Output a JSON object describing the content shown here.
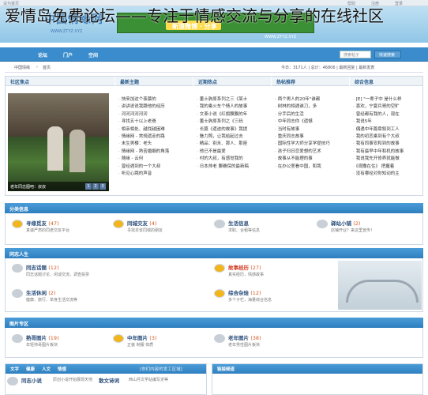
{
  "overlay_title": "爱情岛免费论坛——专注于情感交流与分享的在线社区",
  "top_strip": {
    "left": "设为首页",
    "right": [
      "帮助",
      "注册",
      "登录"
    ]
  },
  "header": {
    "logo": "中国情缘网",
    "url": "WWW.ZTYZ.XYZ",
    "ad_text": "新浪微博 · 分享",
    "ad_url": "WWW.ZTYZ.XYZ"
  },
  "nav": {
    "items": [
      "论坛",
      "门户",
      "空间"
    ],
    "search_placeholder": "搜索帖子",
    "search_button": "快速搜索"
  },
  "crumb": {
    "home": "中国情缘",
    "sep": "›",
    "page": "首页",
    "stats": "今日：3171人 | 总计：46806 | 最新回复 | 最新发表"
  },
  "hot": {
    "columns": [
      "社区焦点",
      "最新主题",
      "近期热点",
      "热帖推荐",
      "综合信息"
    ],
    "photo_caption": "老年同志图吧：叔叔",
    "photo_pages": [
      "1",
      "2",
      "3"
    ],
    "lists": [
      [
        "快来加这个羡慕的",
        "讲讲说说我跟他的经历",
        "河河河河河河",
        "寻找五十以上老爸",
        "相亲相处、越找越困难",
        "情缘网 - 常规遗走的路",
        "未生男楼：老头",
        "情缘网 - 熟苦婚姻的角落",
        "随缘 - 云何",
        "曾经遇到的一个大叔",
        "听见心跳的声音"
      ],
      [
        "董士驹原系列之三《某士",
        "我的乘火车个情人的故事",
        "文革小说《红旗飘飘的年",
        "董士驹原系列之《三码",
        "长篇《遗迹的故事》我提",
        "魅力照，让我给起过去",
        "精品：别永、那人、那座",
        "他已不是最爱",
        "村的大叔，有感觉我的",
        "日本帅老 要确保的最新稿"
      ],
      [
        "两个男人的20年\"谁都",
        "树林的相遇谁刀，多",
        "分手后的生活",
        "中年同志你《遗憾",
        "当时有故事",
        "重庆同志故事",
        "国际性学大师分享学提技巧",
        "孩子归日恋爱想的艺术",
        "故事从不能理的事",
        "在办公室看中国，和我"
      ],
      [
        "[E] \"一辈子中 是什么样",
        "喜欢，宁夏兵哥的空旷",
        "曾经都有我的人，现在",
        "我说5年",
        "偶遇中年篇章叙到工人",
        "我的初恋乘到有个大叔",
        "我有同事安和到的故事",
        "我有最早中年和机的故事",
        "我说我先开修养就能做",
        "《观撒在住》 把握着",
        "没有哪经对你知动的主"
      ]
    ]
  },
  "sections": [
    {
      "title": "分类信息",
      "forums": [
        {
          "name": "寻缘觅友",
          "count": "(47)",
          "desc": "真诚严肃的同老交友平台",
          "hot": true
        },
        {
          "name": "同城交友",
          "count": "(4)",
          "desc": "寻找本省同城的朋友",
          "hot": true
        },
        {
          "name": "生活信息",
          "count": "",
          "desc": "求职、合租等信息",
          "hot": false
        },
        {
          "name": "驿站小铺",
          "count": "(2)",
          "desc": "店铺开业？来这里宣传！",
          "hot": false
        }
      ]
    },
    {
      "title": "同志人生",
      "forums": [
        {
          "name": "同志话题",
          "count": "(12)",
          "desc": "同志话题讨论，闲谈交流，调查投票",
          "hot": false
        },
        {
          "name": "故事经历",
          "count": "(27)",
          "desc": "真实经历，情感故事",
          "hot": true,
          "special": true
        },
        {
          "name": "生活休闲",
          "count": "(2)",
          "desc": "健康、旅行、单身生活交流等",
          "hot": false
        },
        {
          "name": "综合杂烩",
          "count": "(12)",
          "desc": "多个子栏，海量综合信息",
          "hot": true
        }
      ]
    },
    {
      "title": "图片专区",
      "forums": [
        {
          "name": "熟哥图片",
          "count": "(19)",
          "desc": "年轻帅哥图片板块",
          "hot": false
        },
        {
          "name": "中年图片",
          "count": "(3)",
          "desc": "正装 制服 体质",
          "hot": true
        },
        {
          "name": "老年图片",
          "count": "(38)",
          "desc": "老年男性图片板块",
          "hot": false
        }
      ]
    }
  ],
  "bottom": {
    "left_head": [
      "文字",
      "健康",
      "人文",
      "情感"
    ],
    "left_note": "[你们内容的发工区域]",
    "left_items": [
      {
        "name": "同志小说",
        "desc": "原创小说开始展现天地"
      },
      {
        "name": "散文诗词",
        "desc": "西山月文学站编写定等"
      }
    ],
    "right_head": "链接频道"
  }
}
